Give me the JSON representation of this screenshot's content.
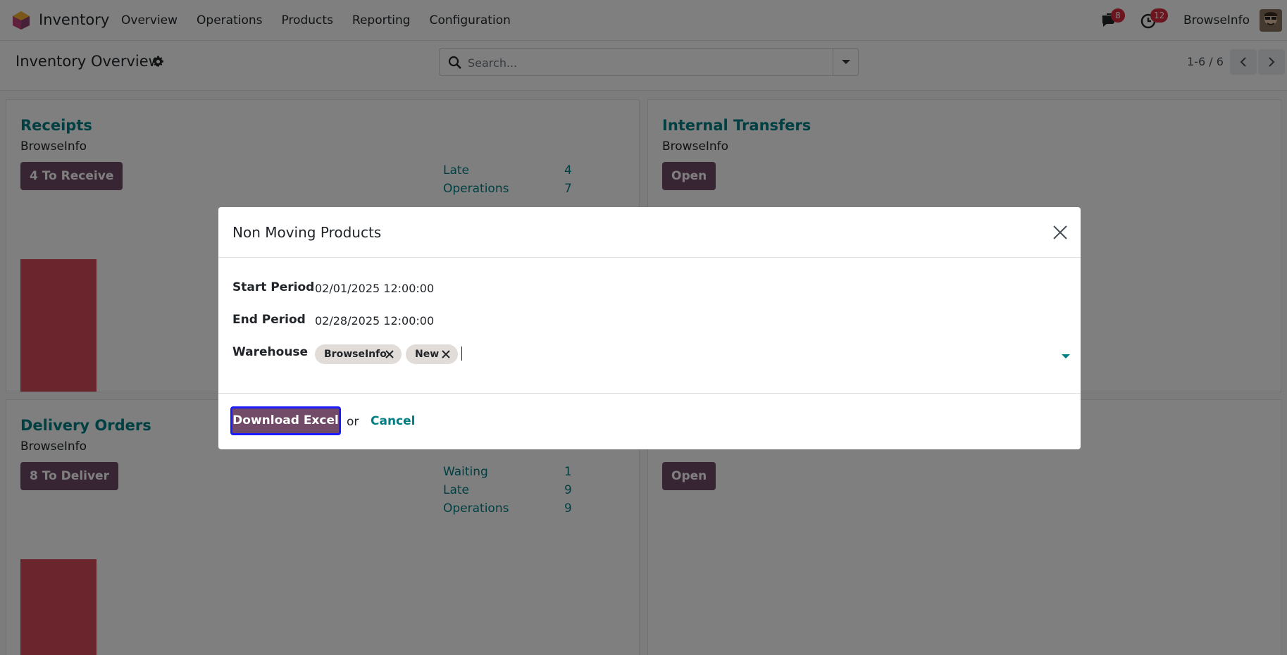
{
  "app": {
    "name": "Inventory"
  },
  "menu": [
    "Overview",
    "Operations",
    "Products",
    "Reporting",
    "Configuration"
  ],
  "systray": {
    "messages_count": "8",
    "activities_count": "12",
    "company": "BrowseInfo"
  },
  "control_panel": {
    "title": "Inventory Overview",
    "search_placeholder": "Search...",
    "pager": "1-6 / 6"
  },
  "cards": {
    "receipts": {
      "title": "Receipts",
      "subtitle": "BrowseInfo",
      "button": "4 To Receive",
      "stats": [
        {
          "label": "Late",
          "value": "4"
        },
        {
          "label": "Operations",
          "value": "7"
        }
      ]
    },
    "internal": {
      "title": "Internal Transfers",
      "subtitle": "BrowseInfo",
      "button": "Open"
    },
    "delivery": {
      "title": "Delivery Orders",
      "subtitle": "BrowseInfo",
      "button": "8 To Deliver",
      "stats": [
        {
          "label": "Waiting",
          "value": "1"
        },
        {
          "label": "Late",
          "value": "9"
        },
        {
          "label": "Operations",
          "value": "9"
        }
      ]
    },
    "fourth": {
      "button": "Open"
    }
  },
  "modal": {
    "title": "Non Moving Products",
    "fields": {
      "start_label": "Start Period",
      "start_value": "02/01/2025 12:00:00",
      "end_label": "End Period",
      "end_value": "02/28/2025 12:00:00",
      "warehouse_label": "Warehouse",
      "warehouse_tags": [
        "BrowseInfo",
        "New"
      ]
    },
    "footer": {
      "download": "Download Excel",
      "or": "or",
      "cancel": "Cancel"
    }
  },
  "colors": {
    "accent": "#017e84",
    "primary": "#714b67",
    "bar": "#d64a5a",
    "badge": "#d92a3d"
  }
}
